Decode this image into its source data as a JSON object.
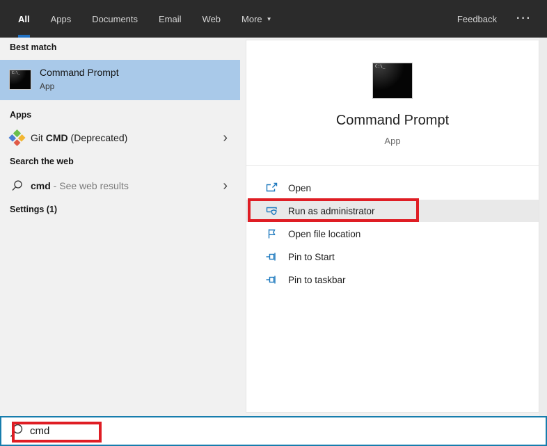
{
  "header": {
    "tabs": [
      {
        "label": "All",
        "active": true
      },
      {
        "label": "Apps",
        "active": false
      },
      {
        "label": "Documents",
        "active": false
      },
      {
        "label": "Email",
        "active": false
      },
      {
        "label": "Web",
        "active": false
      },
      {
        "label": "More",
        "active": false,
        "has_caret": true
      }
    ],
    "feedback_label": "Feedback"
  },
  "icons": {
    "caret_down": "▼",
    "ellipsis": "···",
    "chevron_right": "›"
  },
  "left_panel": {
    "best_match_header": "Best match",
    "best_match": {
      "title": "Command Prompt",
      "subtitle": "App"
    },
    "apps_header": "Apps",
    "apps_item": {
      "prefix": "Git ",
      "bold": "CMD",
      "suffix": " (Deprecated)"
    },
    "search_web_header": "Search the web",
    "search_web_item": {
      "query": "cmd",
      "suffix": " - See web results"
    },
    "settings_header": "Settings (1)"
  },
  "right_panel": {
    "app_title": "Command Prompt",
    "app_subtitle": "App",
    "actions": [
      {
        "label": "Open"
      },
      {
        "label": "Run as administrator",
        "highlighted": true,
        "annotated": true
      },
      {
        "label": "Open file location"
      },
      {
        "label": "Pin to Start"
      },
      {
        "label": "Pin to taskbar"
      }
    ]
  },
  "search_bar": {
    "value": "cmd"
  },
  "colors": {
    "header_bg": "#2b2b2b",
    "tab_underline_blue": "#1f70c2",
    "best_match_highlight": "#a9c9e9",
    "action_icon_blue": "#1a77bd",
    "annotation_red": "#df1d24",
    "searchbar_border_blue": "#177dad",
    "left_panel_bg": "#f1f1f1",
    "highlighted_row_gray": "#e9e9e9"
  },
  "git_icon_colors": {
    "tl": "#6bbf4b",
    "tr": "#f2b632",
    "bl": "#4a7fd4",
    "br": "#e05a47"
  }
}
